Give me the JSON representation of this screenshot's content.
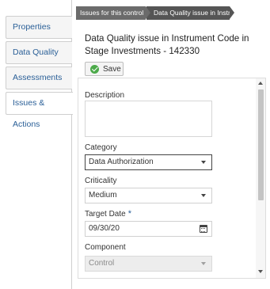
{
  "tabs": [
    {
      "label": "Properties"
    },
    {
      "label": "Data Quality"
    },
    {
      "label": "Assessments"
    },
    {
      "label": "Issues & Actions"
    }
  ],
  "breadcrumbs": [
    {
      "label": "Issues for this control"
    },
    {
      "label": "Data Quality issue in Instr..."
    }
  ],
  "header": {
    "title": "Data Quality issue in Instrument Code in Stage Investments - 142330"
  },
  "toolbar": {
    "save_label": "Save"
  },
  "form": {
    "description_label": "Description",
    "description_value": "",
    "category_label": "Category",
    "category_value": "Data Authorization",
    "criticality_label": "Criticality",
    "criticality_value": "Medium",
    "target_date_label": "Target Date",
    "target_date_required": "*",
    "target_date_value": "09/30/20",
    "component_label": "Component",
    "component_value": "Control"
  },
  "colors": {
    "tab_text": "#2a5f97",
    "breadcrumb_bg": "#6b6b6b",
    "save_icon": "#4caa4a"
  }
}
